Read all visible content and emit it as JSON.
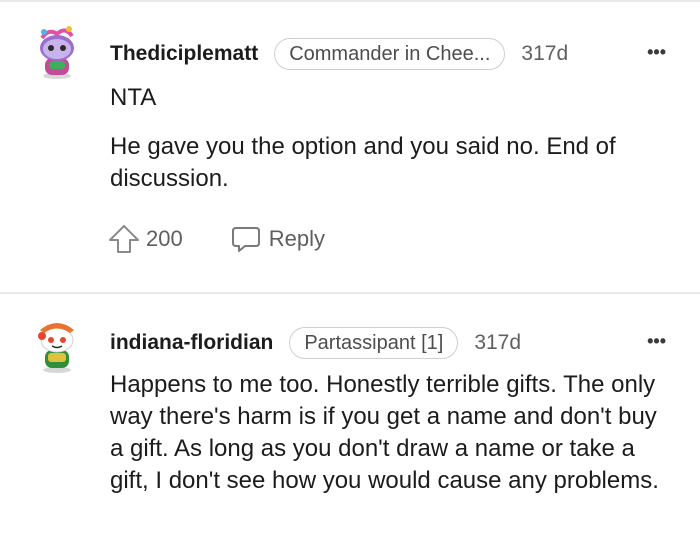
{
  "comments": [
    {
      "username": "Thediciplematt",
      "flair": "Commander in Chee...",
      "age": "317d",
      "more_label": "•••",
      "paragraphs": [
        "NTA",
        "He gave you the option and you said no. End of discussion."
      ],
      "upvotes": "200",
      "reply_label": "Reply",
      "avatar_icon": "snoo-avatar-purple-icon"
    },
    {
      "username": "indiana-floridian",
      "flair": "Partassipant [1]",
      "age": "317d",
      "more_label": "•••",
      "paragraphs": [
        "Happens to me too. Honestly terrible gifts. The only way there's harm is if you get a name and don't buy a gift. As long as you don't draw a name or take a gift, I don't see how you would cause any problems."
      ],
      "avatar_icon": "snoo-avatar-orange-icon"
    }
  ],
  "colors": {
    "text": "#1c1c1c",
    "meta": "#606060",
    "divider": "#e9e9e9",
    "flair_border": "#cfcfcf"
  }
}
